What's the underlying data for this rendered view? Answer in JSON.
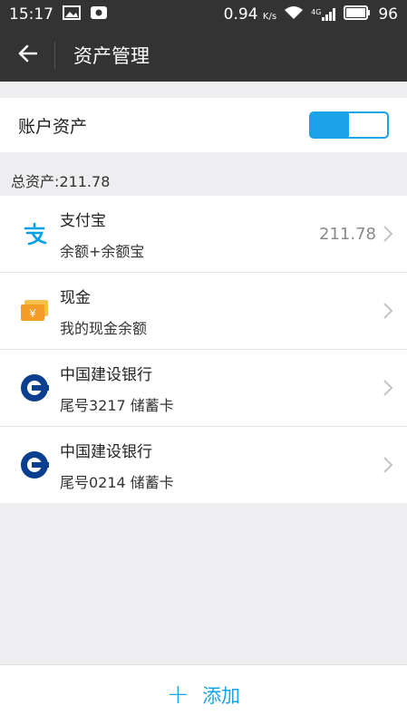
{
  "status_bar": {
    "time": "15:17",
    "network_speed": "0.94",
    "speed_unit": "K/s",
    "battery": "96",
    "signal_label": "4G"
  },
  "header": {
    "title": "资产管理"
  },
  "account": {
    "label": "账户资产",
    "toggle_on": true,
    "accent": "#1aa3e6"
  },
  "total": {
    "label": "总资产:211.78"
  },
  "accounts": [
    {
      "title": "支付宝",
      "subtitle": "余额+余额宝",
      "value": "211.78",
      "icon": "alipay-icon"
    },
    {
      "title": "现金",
      "subtitle": "我的现金余额",
      "value": "",
      "icon": "cash-icon"
    },
    {
      "title": "中国建设银行",
      "subtitle": "尾号3217 储蓄卡",
      "value": "",
      "icon": "ccb-bank-icon"
    },
    {
      "title": "中国建设银行",
      "subtitle": "尾号0214 储蓄卡",
      "value": "",
      "icon": "ccb-bank-icon"
    }
  ],
  "bottom": {
    "add_label": "添加"
  }
}
